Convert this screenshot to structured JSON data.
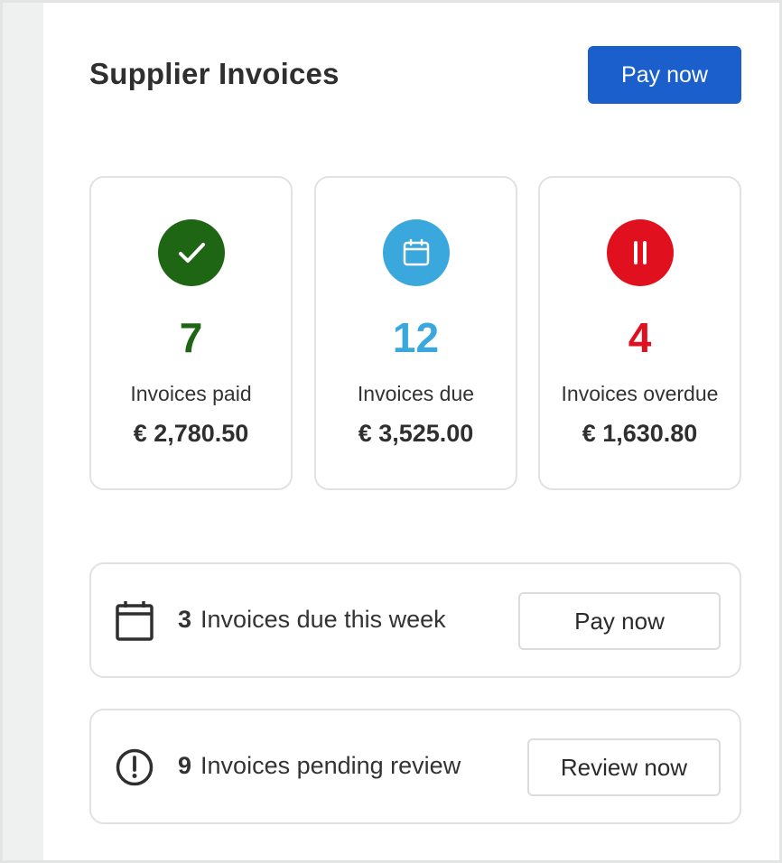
{
  "header": {
    "title": "Supplier Invoices",
    "primary_button": "Pay now"
  },
  "cards": [
    {
      "icon": "check-icon",
      "color": "#1e6614",
      "count": "7",
      "label": "Invoices paid",
      "amount": "€ 2,780.50"
    },
    {
      "icon": "calendar-icon",
      "color": "#3aa8dc",
      "count": "12",
      "label": "Invoices due",
      "amount": "€ 3,525.00"
    },
    {
      "icon": "pause-icon",
      "color": "#e0101f",
      "count": "4",
      "label": "Invoices overdue",
      "amount": "€ 1,630.80"
    }
  ],
  "rows": [
    {
      "icon": "calendar-outline-icon",
      "count": "3",
      "text": "Invoices due this week",
      "button": "Pay now"
    },
    {
      "icon": "alert-circle-icon",
      "count": "9",
      "text": "Invoices pending review",
      "button": "Review now"
    }
  ],
  "colors": {
    "primary": "#1a5fcc",
    "paid": "#1e6614",
    "due": "#3aa8dc",
    "overdue": "#e0101f"
  }
}
